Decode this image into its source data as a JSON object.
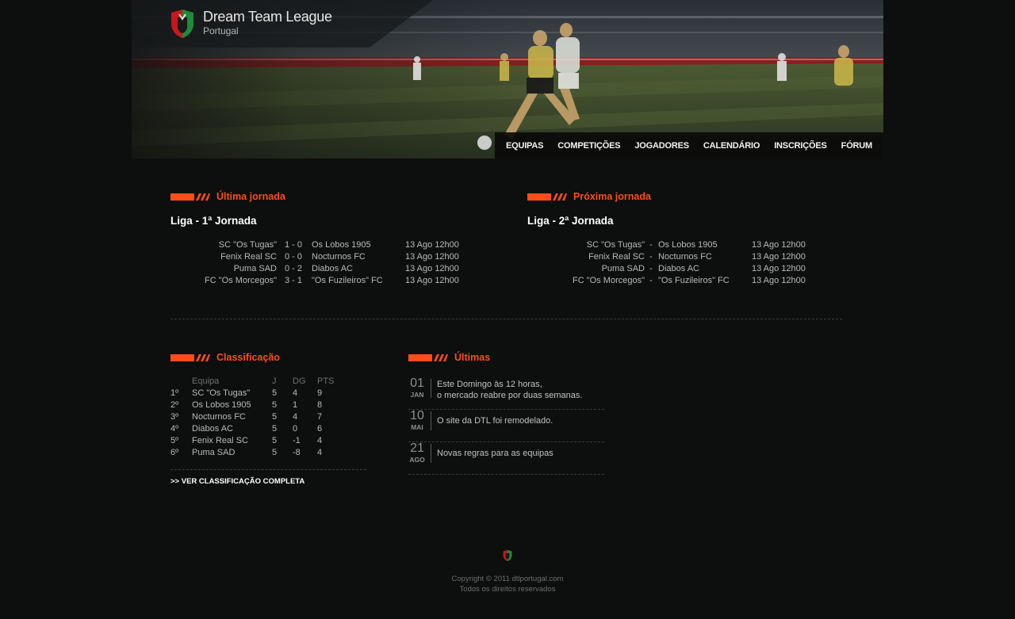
{
  "header": {
    "title": "Dream Team League",
    "subtitle": "Portugal",
    "logo_icon": "shield-logo-icon"
  },
  "nav": [
    {
      "label": "EQUIPAS"
    },
    {
      "label": "COMPETIÇÕES"
    },
    {
      "label": "JOGADORES"
    },
    {
      "label": "CALENDÁRIO"
    },
    {
      "label": "INSCRIÇÕES"
    },
    {
      "label": "FÓRUM"
    }
  ],
  "last_round": {
    "heading": "Última jornada",
    "title": "Liga - 1ª Jornada",
    "matches": [
      {
        "home": "SC \"Os Tugas\"",
        "score": "1 - 0",
        "away": "Os Lobos 1905",
        "date": "13 Ago 12h00"
      },
      {
        "home": "Fenix Real SC",
        "score": "0 - 0",
        "away": "Nocturnos FC",
        "date": "13 Ago 12h00"
      },
      {
        "home": "Puma SAD",
        "score": "0 - 2",
        "away": "Diabos AC",
        "date": "13 Ago 12h00"
      },
      {
        "home": "FC \"Os Morcegos\"",
        "score": "3 - 1",
        "away": "\"Os Fuzileiros\" FC",
        "date": "13 Ago 12h00"
      }
    ]
  },
  "next_round": {
    "heading": "Próxima jornada",
    "title": "Liga - 2ª Jornada",
    "matches": [
      {
        "home": "SC \"Os Tugas\"",
        "score": "-",
        "away": "Os Lobos 1905",
        "date": "13 Ago 12h00"
      },
      {
        "home": "Fenix Real SC",
        "score": "-",
        "away": "Nocturnos FC",
        "date": "13 Ago 12h00"
      },
      {
        "home": "Puma SAD",
        "score": "-",
        "away": "Diabos AC",
        "date": "13 Ago 12h00"
      },
      {
        "home": "FC \"Os Morcegos\"",
        "score": "-",
        "away": "\"Os Fuzileiros\" FC",
        "date": "13 Ago 12h00"
      }
    ]
  },
  "standings": {
    "heading": "Classificação",
    "columns": [
      "Equipa",
      "J",
      "DG",
      "PTS"
    ],
    "rows": [
      {
        "pos": "1º",
        "team": "SC \"Os Tugas\"",
        "j": "5",
        "dg": "4",
        "pts": "9"
      },
      {
        "pos": "2º",
        "team": "Os Lobos 1905",
        "j": "5",
        "dg": "1",
        "pts": "8"
      },
      {
        "pos": "3º",
        "team": "Nocturnos FC",
        "j": "5",
        "dg": "4",
        "pts": "7"
      },
      {
        "pos": "4º",
        "team": "Diabos AC",
        "j": "5",
        "dg": "0",
        "pts": "6"
      },
      {
        "pos": "5º",
        "team": "Fenix Real SC",
        "j": "5",
        "dg": "-1",
        "pts": "4"
      },
      {
        "pos": "6º",
        "team": "Puma SAD",
        "j": "5",
        "dg": "-8",
        "pts": "4"
      }
    ],
    "full_link": ">> VER CLASSIFICAÇÃO COMPLETA"
  },
  "news": {
    "heading": "Últimas",
    "items": [
      {
        "day": "01",
        "month": "JAN",
        "line1": "Este Domingo às 12 horas,",
        "line2": "o mercado reabre por duas semanas."
      },
      {
        "day": "10",
        "month": "MAI",
        "line1": "O site da DTL foi remodelado.",
        "line2": ""
      },
      {
        "day": "21",
        "month": "AGO",
        "line1": "Novas regras para as equipas",
        "line2": ""
      }
    ]
  },
  "footer": {
    "copyright": "Copyright © 2011 dtlportugal.com",
    "rights": "Todos os direitos reservados"
  },
  "colors": {
    "accent": "#ff4d1a",
    "background": "#0d0e0e",
    "logo_red": "#c8161d",
    "logo_green": "#1e8a3a"
  }
}
